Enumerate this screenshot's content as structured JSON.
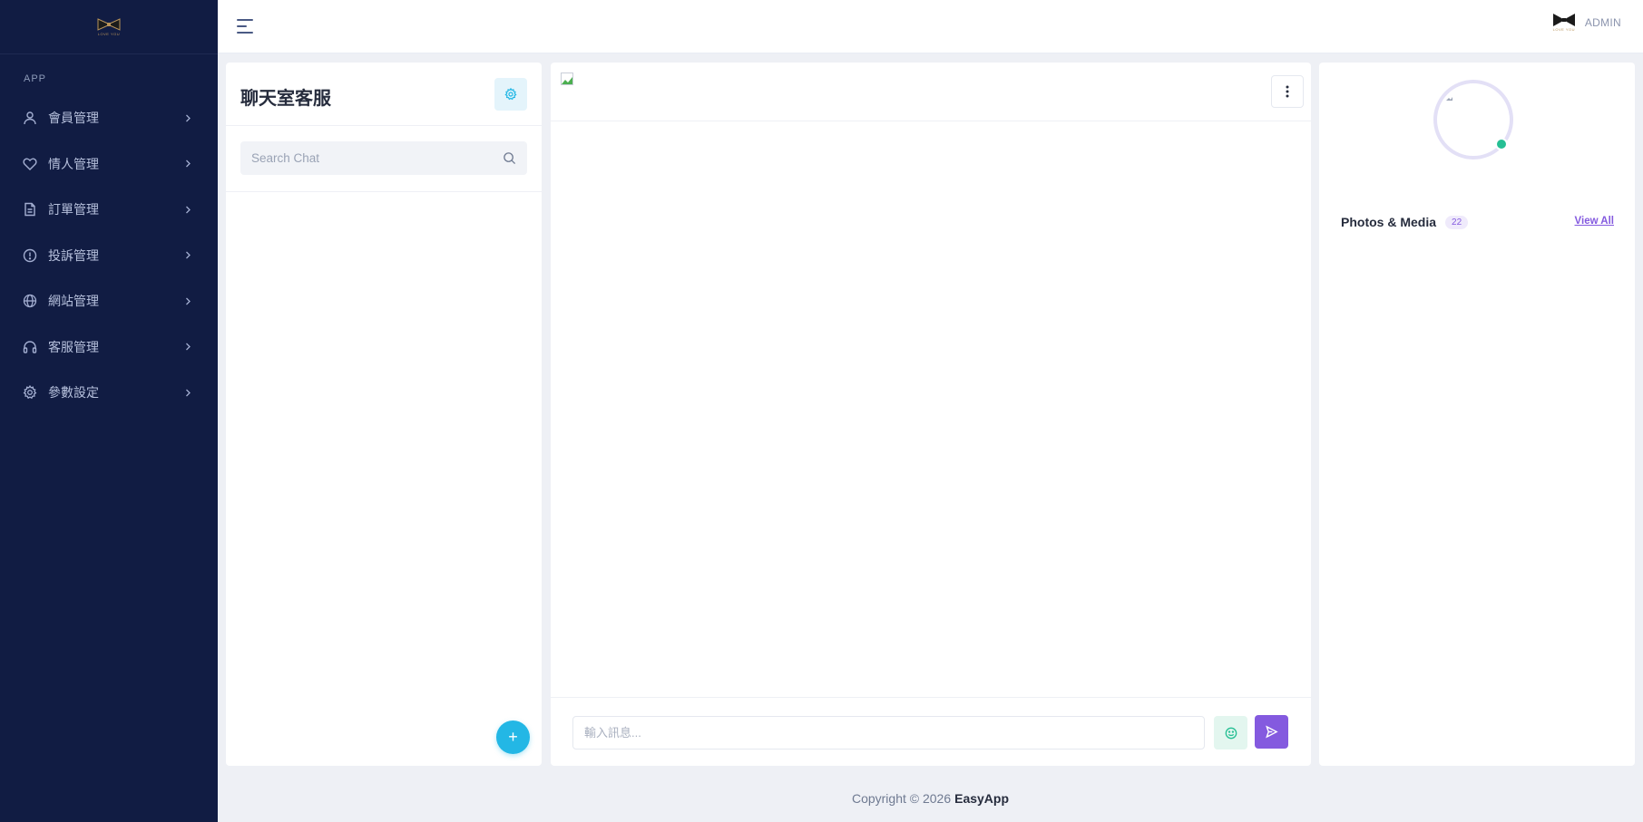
{
  "app": {
    "brand_name": "EasyApp",
    "logo_text": "LOVE YOU"
  },
  "sidebar": {
    "category": "APP",
    "items": [
      {
        "label": "會員管理",
        "icon": "user-icon"
      },
      {
        "label": "情人管理",
        "icon": "heart-icon"
      },
      {
        "label": "訂單管理",
        "icon": "document-icon"
      },
      {
        "label": "投訴管理",
        "icon": "info-circle-icon"
      },
      {
        "label": "網站管理",
        "icon": "globe-icon"
      },
      {
        "label": "客服管理",
        "icon": "headset-icon"
      },
      {
        "label": "參數設定",
        "icon": "gear-icon"
      }
    ]
  },
  "header": {
    "user_name": "ADMIN"
  },
  "chat_list": {
    "title": "聊天室客服",
    "search_placeholder": "Search Chat",
    "fab_label": "+"
  },
  "chat_main": {
    "input_placeholder": "輸入訊息..."
  },
  "profile": {
    "media_title": "Photos & Media",
    "media_count": "22",
    "view_all": "View All",
    "status": "online"
  },
  "footer": {
    "copyright": "Copyright © 2026",
    "brand": "EasyApp"
  },
  "colors": {
    "sidebar_bg": "#111c43",
    "primary": "#845adf",
    "info": "#23b7e5",
    "success": "#26bf94",
    "page_bg": "#eef0f5"
  }
}
